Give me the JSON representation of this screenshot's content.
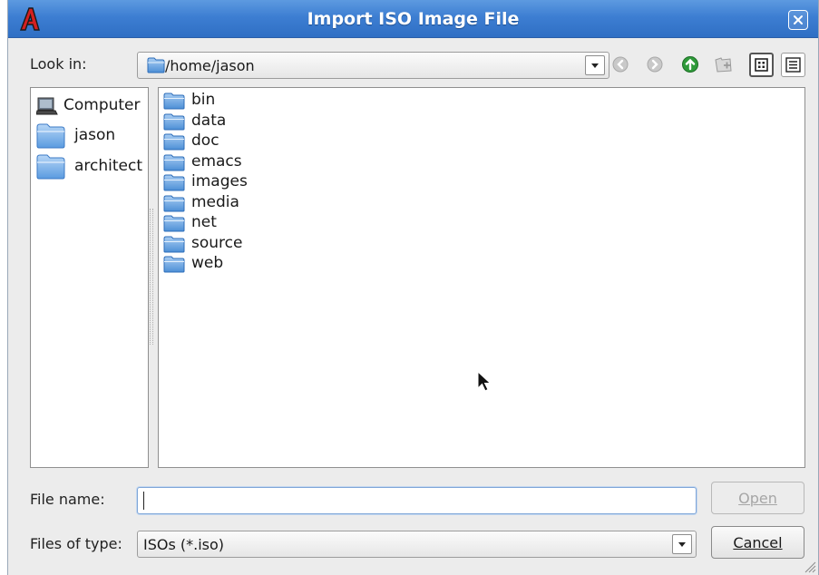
{
  "window": {
    "title": "Import ISO Image File",
    "app_icon": "red-a-logo-icon",
    "close_icon": "close-icon",
    "title_bar_color": "#3d7ed2"
  },
  "look_in": {
    "label": "Look in:",
    "value": "/home/jason"
  },
  "toolbar": {
    "icons": [
      "back-icon",
      "forward-icon",
      "parent-directory-icon",
      "new-folder-icon",
      "list-view-icon",
      "detail-view-icon"
    ],
    "active_view": "list-view-icon"
  },
  "sidebar": {
    "items": [
      {
        "label": "Computer",
        "icon": "computer-icon"
      },
      {
        "label": "jason",
        "icon": "folder-icon"
      },
      {
        "label": "architect",
        "icon": "folder-icon"
      }
    ]
  },
  "files": {
    "items": [
      {
        "name": "bin",
        "icon": "folder-icon"
      },
      {
        "name": "data",
        "icon": "folder-icon"
      },
      {
        "name": "doc",
        "icon": "folder-icon"
      },
      {
        "name": "emacs",
        "icon": "folder-icon"
      },
      {
        "name": "images",
        "icon": "folder-icon"
      },
      {
        "name": "media",
        "icon": "folder-icon"
      },
      {
        "name": "net",
        "icon": "folder-icon"
      },
      {
        "name": "source",
        "icon": "folder-icon"
      },
      {
        "name": "web",
        "icon": "folder-icon"
      }
    ]
  },
  "file_name": {
    "label": "File name:",
    "value": "",
    "mnemonic": "n"
  },
  "file_type": {
    "label": "Files of type:",
    "value": "ISOs (*.iso)"
  },
  "buttons": {
    "open": "Open",
    "open_enabled": false,
    "cancel": "Cancel"
  }
}
